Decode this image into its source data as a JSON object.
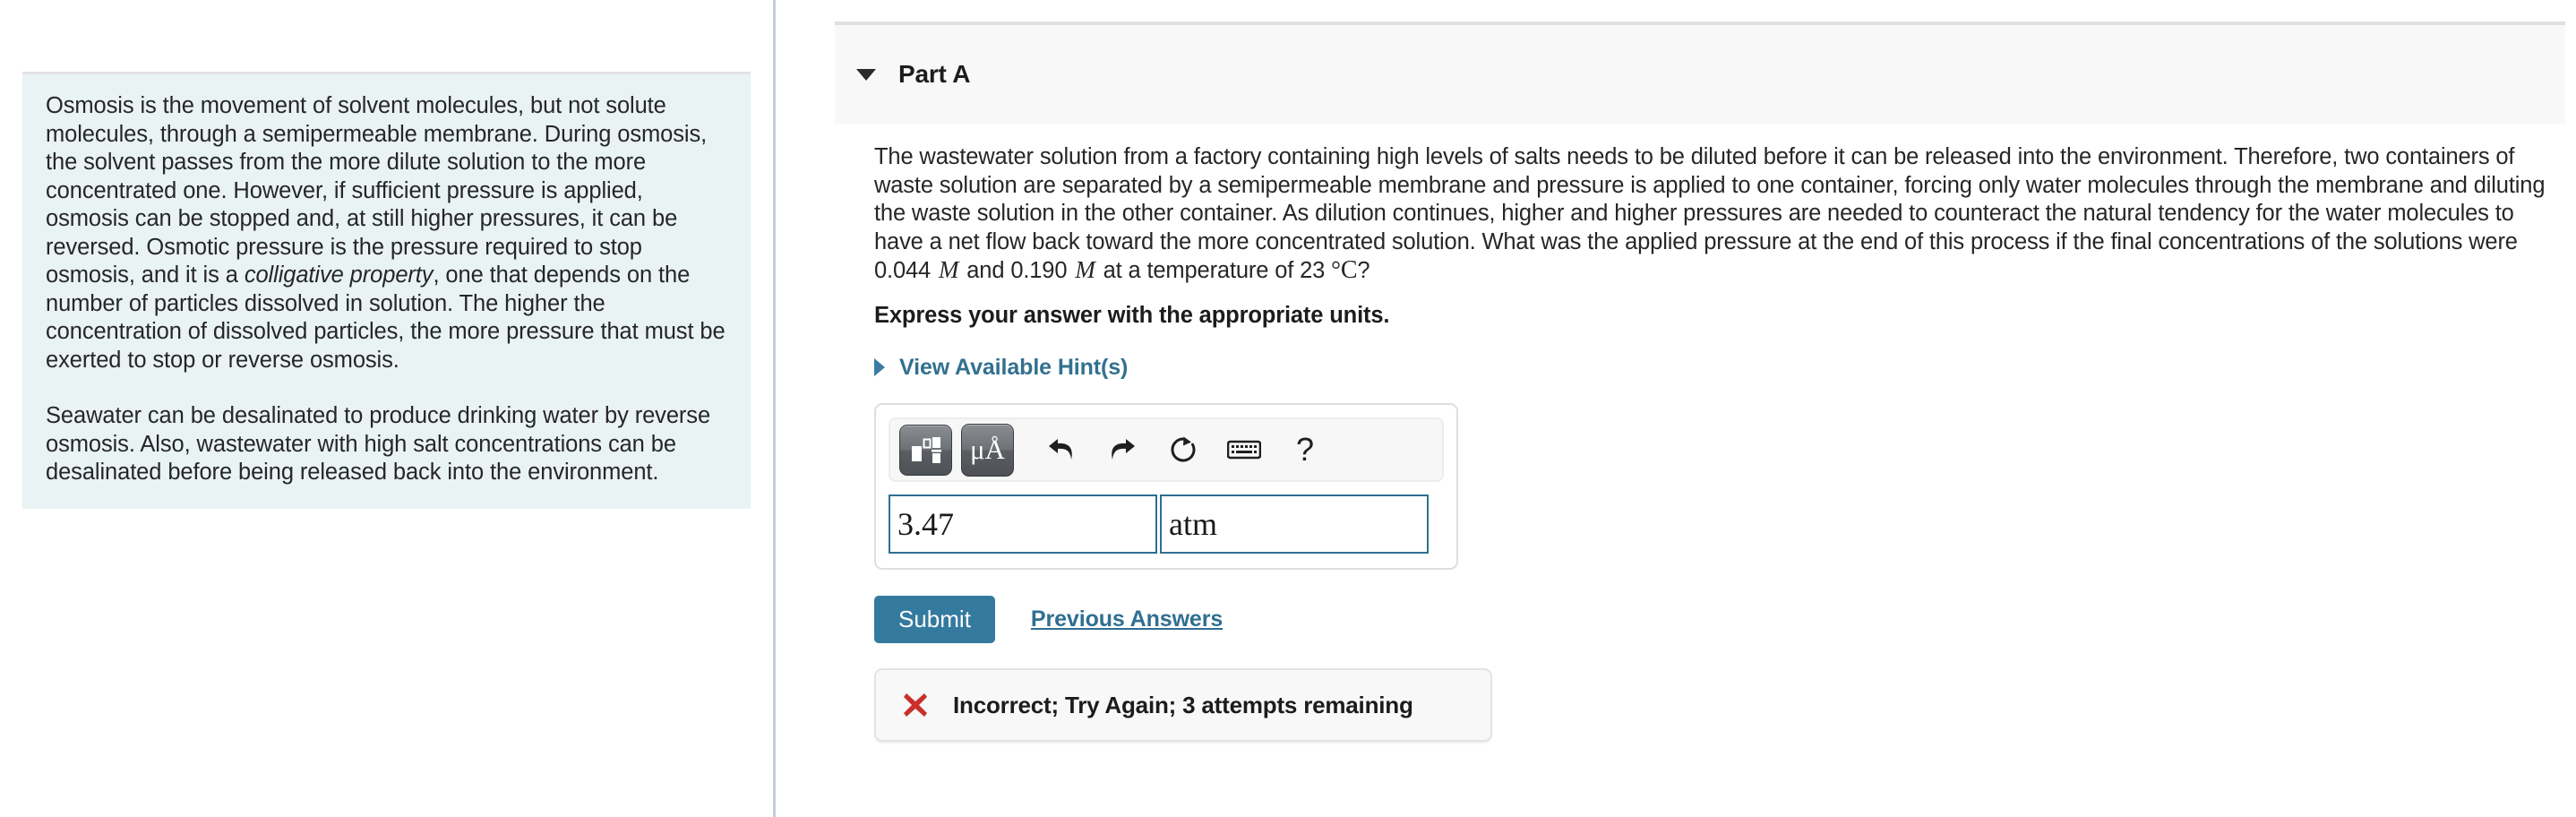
{
  "left_panel": {
    "paragraphs": [
      "Osmosis is the movement of solvent molecules, but not solute molecules, through a semipermeable membrane. During osmosis, the solvent passes from the more dilute solution to the more concentrated one. However, if sufficient pressure is applied, osmosis can be stopped and, at still higher pressures, it can be reversed. Osmotic pressure is the pressure required to stop osmosis, and it is a ",
      "Seawater can be desalinated to produce drinking water by reverse osmosis. Also, wastewater with high salt concentrations can be desalinated before being released back into the environment."
    ],
    "emphasis_term": "colligative property",
    "paragraph1_tail": ", one that depends on the number of particles dissolved in solution. The higher the concentration of dissolved particles, the more pressure that must be exerted to stop or reverse osmosis."
  },
  "part": {
    "title": "Part A",
    "collapse_icon": "caret-down-icon",
    "question_segments": {
      "lead": "The wastewater solution from a factory containing high levels of salts needs to be diluted before it can be released into the environment. Therefore, two containers of waste solution are separated by a semipermeable membrane and pressure is applied to one container, forcing only water molecules through the membrane and diluting the waste solution in the other container. As dilution continues, higher and higher pressures are needed to counteract the natural tendency for the water molecules to have a net flow back toward the more concentrated solution. What was the applied pressure at the end of this process if the final concentrations of the solutions were ",
      "conc1_value": "0.044",
      "conc1_unit": "M",
      "between_concs": " and ",
      "conc2_value": "0.190",
      "conc2_unit": "M",
      "temp_lead": " at a temperature of ",
      "temp_value": "23",
      "temp_degree": "°",
      "temp_unit": "C",
      "tail": "?"
    },
    "instruction": "Express your answer with the appropriate units.",
    "hints_label": "View Available Hint(s)",
    "hints_icon": "caret-right-icon"
  },
  "answer": {
    "toolbar": {
      "template_button": "math-template-icon",
      "units_button": "μÅ",
      "undo_icon": "undo-arrow-icon",
      "redo_icon": "redo-arrow-icon",
      "reset_icon": "reset-circular-arrow-icon",
      "keyboard_icon": "keyboard-icon",
      "help_icon": "?"
    },
    "value": "3.47",
    "units": "atm",
    "value_placeholder": "",
    "units_placeholder": ""
  },
  "actions": {
    "submit_label": "Submit",
    "previous_answers_label": "Previous Answers"
  },
  "feedback": {
    "icon": "red-x-icon",
    "message": "Incorrect; Try Again; 3 attempts remaining"
  },
  "colors": {
    "intro_bg": "#e9f3f4",
    "link_blue": "#32708f",
    "submit_blue": "#337a9e",
    "input_border": "#2f6f91",
    "error_red": "#c9302c",
    "divider": "#c3ceda",
    "header_bg": "#f8f8f8"
  }
}
